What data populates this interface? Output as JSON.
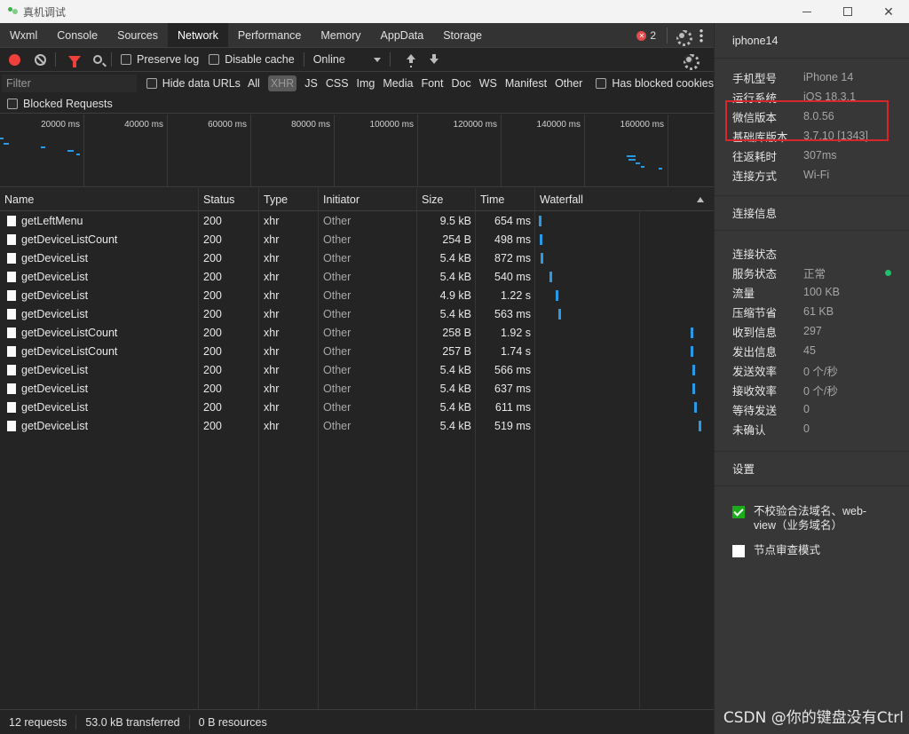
{
  "window": {
    "title": "真机调试"
  },
  "tabs": [
    "Wxml",
    "Console",
    "Sources",
    "Network",
    "Performance",
    "Memory",
    "AppData",
    "Storage"
  ],
  "active_tab": "Network",
  "error_count": "2",
  "toolbar": {
    "preserve_log": "Preserve log",
    "disable_cache": "Disable cache",
    "throttle": "Online"
  },
  "filter": {
    "placeholder": "Filter",
    "hide_data_urls": "Hide data URLs",
    "types": [
      "All",
      "XHR",
      "JS",
      "CSS",
      "Img",
      "Media",
      "Font",
      "Doc",
      "WS",
      "Manifest",
      "Other"
    ],
    "active_type": "XHR",
    "has_blocked_cookies": "Has blocked cookies",
    "blocked_requests": "Blocked Requests"
  },
  "overview": {
    "ticks": [
      "20000 ms",
      "40000 ms",
      "60000 ms",
      "80000 ms",
      "100000 ms",
      "120000 ms",
      "140000 ms",
      "160000 ms"
    ]
  },
  "columns": [
    "Name",
    "Status",
    "Type",
    "Initiator",
    "Size",
    "Time",
    "Waterfall"
  ],
  "requests": [
    {
      "name": "getLeftMenu",
      "status": "200",
      "type": "xhr",
      "initiator": "Other",
      "size": "9.5 kB",
      "time": "654 ms"
    },
    {
      "name": "getDeviceListCount",
      "status": "200",
      "type": "xhr",
      "initiator": "Other",
      "size": "254 B",
      "time": "498 ms"
    },
    {
      "name": "getDeviceList",
      "status": "200",
      "type": "xhr",
      "initiator": "Other",
      "size": "5.4 kB",
      "time": "872 ms"
    },
    {
      "name": "getDeviceList",
      "status": "200",
      "type": "xhr",
      "initiator": "Other",
      "size": "5.4 kB",
      "time": "540 ms"
    },
    {
      "name": "getDeviceList",
      "status": "200",
      "type": "xhr",
      "initiator": "Other",
      "size": "4.9 kB",
      "time": "1.22 s"
    },
    {
      "name": "getDeviceList",
      "status": "200",
      "type": "xhr",
      "initiator": "Other",
      "size": "5.4 kB",
      "time": "563 ms"
    },
    {
      "name": "getDeviceListCount",
      "status": "200",
      "type": "xhr",
      "initiator": "Other",
      "size": "258 B",
      "time": "1.92 s"
    },
    {
      "name": "getDeviceListCount",
      "status": "200",
      "type": "xhr",
      "initiator": "Other",
      "size": "257 B",
      "time": "1.74 s"
    },
    {
      "name": "getDeviceList",
      "status": "200",
      "type": "xhr",
      "initiator": "Other",
      "size": "5.4 kB",
      "time": "566 ms"
    },
    {
      "name": "getDeviceList",
      "status": "200",
      "type": "xhr",
      "initiator": "Other",
      "size": "5.4 kB",
      "time": "637 ms"
    },
    {
      "name": "getDeviceList",
      "status": "200",
      "type": "xhr",
      "initiator": "Other",
      "size": "5.4 kB",
      "time": "611 ms"
    },
    {
      "name": "getDeviceList",
      "status": "200",
      "type": "xhr",
      "initiator": "Other",
      "size": "5.4 kB",
      "time": "519 ms"
    }
  ],
  "status_bar": {
    "requests": "12 requests",
    "transferred": "53.0 kB transferred",
    "resources": "0 B resources"
  },
  "device_panel": {
    "device_name": "iphone14",
    "info": [
      {
        "k": "手机型号",
        "v": "iPhone 14"
      },
      {
        "k": "运行系统",
        "v": "iOS 18.3.1"
      },
      {
        "k": "微信版本",
        "v": "8.0.56"
      },
      {
        "k": "基础库版本",
        "v": "3.7.10 [1343]"
      },
      {
        "k": "往返耗时",
        "v": "307ms"
      },
      {
        "k": "连接方式",
        "v": "Wi-Fi"
      }
    ],
    "conn_title": "连接信息",
    "conn": [
      {
        "k": "连接状态",
        "v": ""
      },
      {
        "k": "服务状态",
        "v": "正常"
      },
      {
        "k": "流量",
        "v": "100 KB"
      },
      {
        "k": "压缩节省",
        "v": "61 KB"
      },
      {
        "k": "收到信息",
        "v": "297"
      },
      {
        "k": "发出信息",
        "v": "45"
      },
      {
        "k": "发送效率",
        "v": "0 个/秒"
      },
      {
        "k": "接收效率",
        "v": "0 个/秒"
      },
      {
        "k": "等待发送",
        "v": "0"
      },
      {
        "k": "未确认",
        "v": "0"
      }
    ],
    "settings_title": "设置",
    "settings": [
      {
        "label": "不校验合法域名、web-view（业务域名）",
        "checked": true
      },
      {
        "label": "节点审查模式",
        "checked": false
      }
    ],
    "status_color": "#1ec06b"
  },
  "watermark": "CSDN @你的键盘没有Ctrl"
}
